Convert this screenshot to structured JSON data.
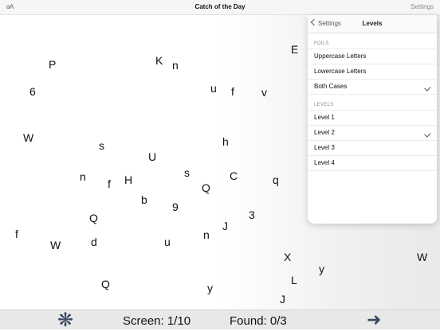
{
  "header": {
    "font_toggle": "aA",
    "title": "Catch of the Day",
    "settings": "Settings"
  },
  "popover": {
    "back_label": "Settings",
    "title": "Levels",
    "foils_heading": "FOILS",
    "foils": [
      {
        "label": "Uppercase Letters",
        "checked": false
      },
      {
        "label": "Lowercase Letters",
        "checked": false
      },
      {
        "label": "Both Cases",
        "checked": true
      }
    ],
    "levels_heading": "LEVELS",
    "levels": [
      {
        "label": "Level 1",
        "checked": false
      },
      {
        "label": "Level 2",
        "checked": true
      },
      {
        "label": "Level 3",
        "checked": false
      },
      {
        "label": "Level 4",
        "checked": false
      }
    ]
  },
  "letters": [
    "P",
    "K",
    "n",
    "E",
    "6",
    "u",
    "f",
    "v",
    "W",
    "s",
    "h",
    "U",
    "n",
    "f",
    "H",
    "s",
    "C",
    "q",
    "Q",
    "b",
    "9",
    "3",
    "Q",
    "J",
    "f",
    "W",
    "d",
    "u",
    "n",
    "X",
    "W",
    "y",
    "Q",
    "L",
    "y",
    "J"
  ],
  "footer": {
    "asterisk_icon": "asterisk-icon",
    "screen": "Screen: 1/10",
    "found": "Found: 0/3",
    "arrow_icon": "right-arrow-icon"
  }
}
